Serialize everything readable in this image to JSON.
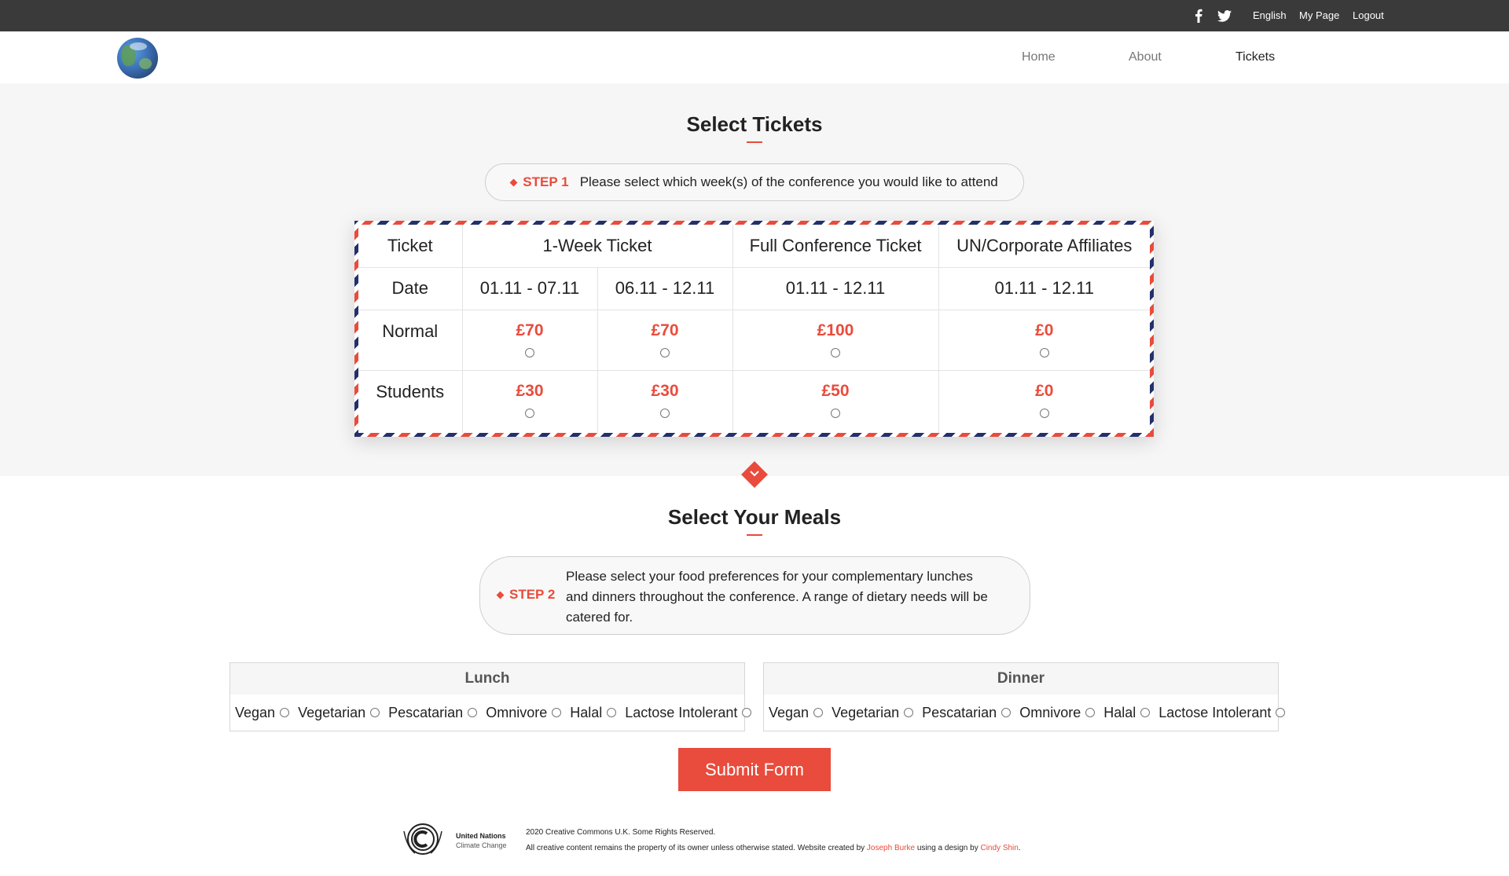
{
  "topbar": {
    "social": [
      "facebook-icon",
      "twitter-icon"
    ],
    "links": [
      "English",
      "My Page",
      "Logout"
    ]
  },
  "nav": {
    "logo_icon": "earth-globe-icon",
    "links": [
      "Home",
      "About",
      "Tickets"
    ],
    "active": "Tickets"
  },
  "tickets_section": {
    "title": "Select Tickets",
    "step": {
      "label": "STEP 1",
      "text": "Please select which week(s) of the conference you would like to attend"
    },
    "table": {
      "headers": {
        "ticket": "Ticket",
        "one_week": "1-Week Ticket",
        "full": "Full Conference Ticket",
        "un": "UN/Corporate Affiliates"
      },
      "date_label": "Date",
      "dates": [
        "01.11 - 07.11",
        "06.11 - 12.11",
        "01.11 - 12.11",
        "01.11 - 12.11"
      ],
      "rows": [
        {
          "label": "Normal",
          "prices": [
            "£70",
            "£70",
            "£100",
            "£0"
          ]
        },
        {
          "label": "Students",
          "prices": [
            "£30",
            "£30",
            "£50",
            "£0"
          ]
        }
      ]
    }
  },
  "meals_section": {
    "title": "Select Your Meals",
    "step": {
      "label": "STEP 2",
      "lines": [
        "Please select your food preferences for your complementary lunches",
        "and dinners throughout the conference. A range of dietary needs will be",
        "catered for."
      ]
    },
    "lunch": {
      "title": "Lunch",
      "options": [
        "Vegan",
        "Vegetarian",
        "Pescatarian",
        "Omnivore",
        "Halal",
        "Lactose Intolerant"
      ]
    },
    "dinner": {
      "title": "Dinner",
      "options": [
        "Vegan",
        "Vegetarian",
        "Pescatarian",
        "Omnivore",
        "Halal",
        "Lactose Intolerant"
      ]
    },
    "submit_label": "Submit Form"
  },
  "footer": {
    "logo_icon": "un-climate-change-logo",
    "org_line1": "United Nations",
    "org_line2": "Climate Change",
    "copyright": "2020 Creative Commons U.K. Some Rights Reserved.",
    "credit_prefix": "All creative content remains the property of its owner unless otherwise stated. Website created by",
    "credit_author": "Joseph Burke",
    "credit_mid": "using a design by",
    "credit_designer": "Cindy Shin",
    "credit_suffix": "."
  },
  "colors": {
    "accent": "#e94b3c",
    "topbar": "#3a3a3a",
    "airmail_blue": "#23306b",
    "section_bg": "#f6f6f6"
  }
}
